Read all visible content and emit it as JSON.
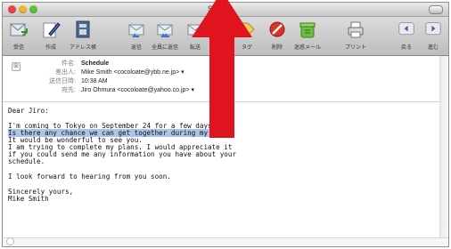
{
  "window": {
    "title": "Sc"
  },
  "toolbar": [
    {
      "label": "受信",
      "icon": "get-mail-icon"
    },
    {
      "label": "作成",
      "icon": "compose-icon"
    },
    {
      "label": "アドレス帳",
      "icon": "address-book-icon"
    },
    {
      "label": "返信",
      "icon": "reply-icon"
    },
    {
      "label": "全員に返信",
      "icon": "reply-all-icon"
    },
    {
      "label": "転送",
      "icon": "forward-icon"
    },
    {
      "label": "タグ",
      "icon": "tag-icon"
    },
    {
      "label": "削除",
      "icon": "delete-icon"
    },
    {
      "label": "迷惑メール",
      "icon": "junk-icon"
    },
    {
      "label": "プリント",
      "icon": "print-icon"
    },
    {
      "label": "戻る",
      "icon": "back-icon"
    },
    {
      "label": "進む",
      "icon": "forward-nav-icon"
    }
  ],
  "headers": {
    "subject_label": "件名:",
    "subject": "Schedule",
    "from_label": "差出人:",
    "from": "Mike Smith <cocoloate@ybb.ne.jp> ▾",
    "date_label": "送信日時:",
    "date": "10:38 AM",
    "to_label": "宛先:",
    "to": "Jiro Ohmura <cocoloate@yahoo.co.jp> ▾"
  },
  "message": {
    "greeting": "Dear Jiro:",
    "line1": "I'm coming to Tokyo on September 24 for a few days.",
    "line2_highlighted": "Is there any chance we can get together during my stay?",
    "line3": "It would be wonderful to see you.",
    "line4": "I am trying to complete my plans. I would appreciate it",
    "line5": "if you could send me any information you have about your",
    "line6": "schedule.",
    "line7": "I look forward to hearing from you soon.",
    "closing": "Sincerely yours,",
    "signature": "Mike Smith"
  },
  "colors": {
    "selection": "#aac4ea",
    "annotation_arrow": "#e0141e",
    "close": "#e8463f",
    "minimize": "#f3b431",
    "zoom": "#5ec13f"
  }
}
